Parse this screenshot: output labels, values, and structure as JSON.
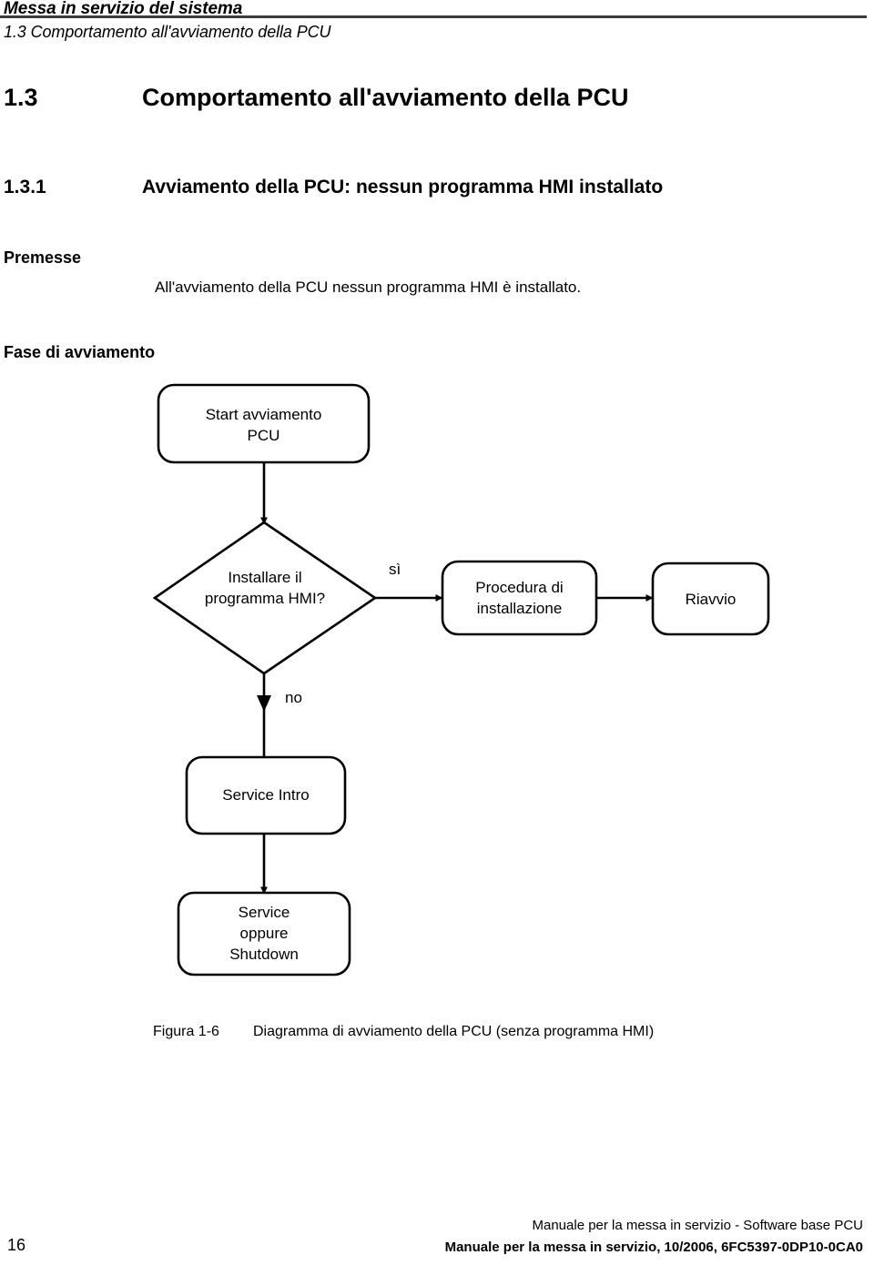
{
  "header": {
    "title": "Messa in servizio del sistema",
    "subtitle": "1.3 Comportamento all'avviamento della PCU",
    "rule_color": "#3b3b41"
  },
  "headings": {
    "h1_number": "1.3",
    "h1_text": "Comportamento all'avviamento della PCU",
    "h2_number": "1.3.1",
    "h2_text": "Avviamento della PCU: nessun programma HMI installato"
  },
  "sections": {
    "premesse_label": "Premesse",
    "premesse_body": "All'avviamento della PCU nessun programma HMI è installato.",
    "fase_label": "Fase di avviamento"
  },
  "flowchart": {
    "nodes": [
      {
        "id": "start",
        "shape": "rounded-rect",
        "label": "Start avviamento\nPCU"
      },
      {
        "id": "decision",
        "shape": "diamond",
        "label": "Installare il\nprogramma HMI?"
      },
      {
        "id": "install",
        "shape": "rounded-rect",
        "label": "Procedura di\ninstallazione"
      },
      {
        "id": "restart",
        "shape": "rounded-rect",
        "label": "Riavvio"
      },
      {
        "id": "service-intro",
        "shape": "rounded-rect",
        "label": "Service Intro"
      },
      {
        "id": "service-shutdown",
        "shape": "rounded-rect",
        "label": "Service\noppure\nShutdown"
      }
    ],
    "edges": [
      {
        "from": "start",
        "to": "decision",
        "label": ""
      },
      {
        "from": "decision",
        "to": "install",
        "label": "sì"
      },
      {
        "from": "install",
        "to": "restart",
        "label": ""
      },
      {
        "from": "decision",
        "to": "service-intro",
        "label": "no"
      },
      {
        "from": "service-intro",
        "to": "service-shutdown",
        "label": ""
      }
    ],
    "stroke_color": "#000000"
  },
  "figure": {
    "number": "Figura 1-6",
    "caption": "Diagramma di avviamento della PCU (senza programma HMI)"
  },
  "footer": {
    "page_number": "16",
    "line1": "Manuale per la messa in servizio - Software base PCU",
    "line2": "Manuale per la messa in servizio, 10/2006, 6FC5397-0DP10-0CA0"
  }
}
